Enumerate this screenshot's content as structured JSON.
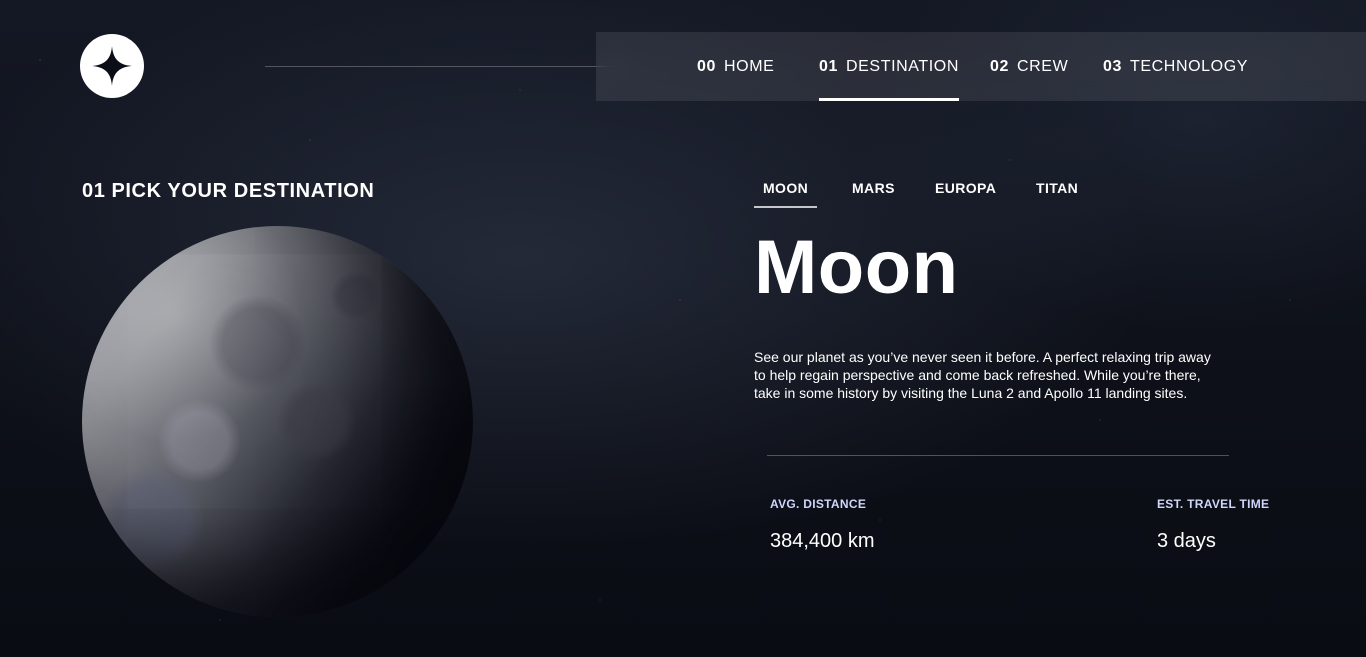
{
  "logo": {
    "icon": "four-point-star-icon"
  },
  "nav": {
    "items": [
      {
        "num": "00",
        "label": "HOME",
        "active": false
      },
      {
        "num": "01",
        "label": "DESTINATION",
        "active": true
      },
      {
        "num": "02",
        "label": "CREW",
        "active": false
      },
      {
        "num": "03",
        "label": "TECHNOLOGY",
        "active": false
      }
    ]
  },
  "section": {
    "num": "01",
    "title": "PICK YOUR DESTINATION"
  },
  "tabs": [
    {
      "label": "MOON",
      "active": true
    },
    {
      "label": "MARS",
      "active": false
    },
    {
      "label": "EUROPA",
      "active": false
    },
    {
      "label": "TITAN",
      "active": false
    }
  ],
  "destination": {
    "name": "Moon",
    "description": "See our planet as you’ve never seen it before. A perfect relaxing trip away to help regain perspective and come back refreshed. While you’re there, take in some history by visiting the Luna 2 and Apollo 11 landing sites.",
    "stats": [
      {
        "label": "AVG. DISTANCE",
        "value": "384,400 km"
      },
      {
        "label": "EST. TRAVEL TIME",
        "value": "3 days"
      }
    ]
  },
  "colors": {
    "background": "#0b0d17",
    "accent": "#d0d6f9",
    "text": "#ffffff"
  }
}
